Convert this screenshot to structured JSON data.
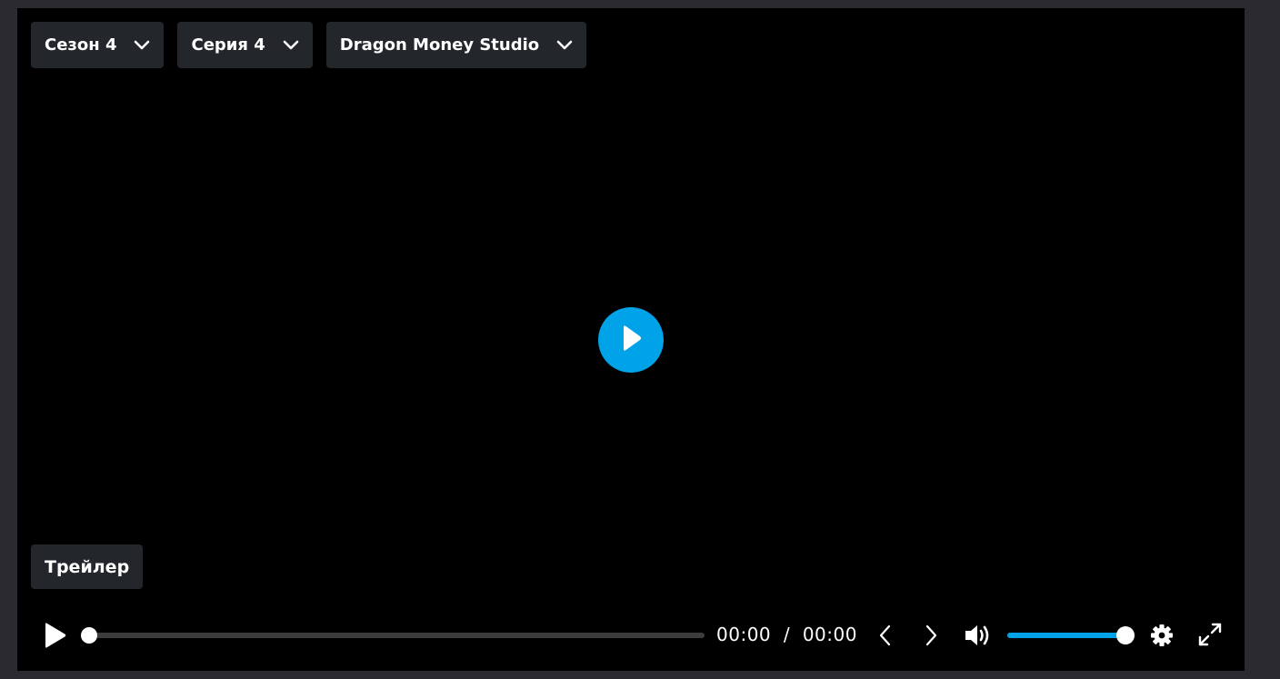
{
  "selectors": {
    "season": "Сезон 4",
    "episode": "Серия 4",
    "studio": "Dragon Money Studio"
  },
  "trailer_label": "Трейлер",
  "player": {
    "current_time": "00:00",
    "separator": "/",
    "duration": "00:00",
    "progress_fraction": 0,
    "volume_fraction": 1.0
  },
  "icons": {
    "dropdown": "chevron-down-icon",
    "big_play": "play-icon",
    "play": "play-icon",
    "prev": "chevron-left-icon",
    "next": "chevron-right-icon",
    "volume": "volume-icon",
    "settings": "gear-icon",
    "fullscreen": "fullscreen-icon"
  },
  "colors": {
    "accent": "#00a2e8",
    "button_bg": "#23272c",
    "player_bg": "#000000",
    "page_bg": "#2b2a30"
  }
}
